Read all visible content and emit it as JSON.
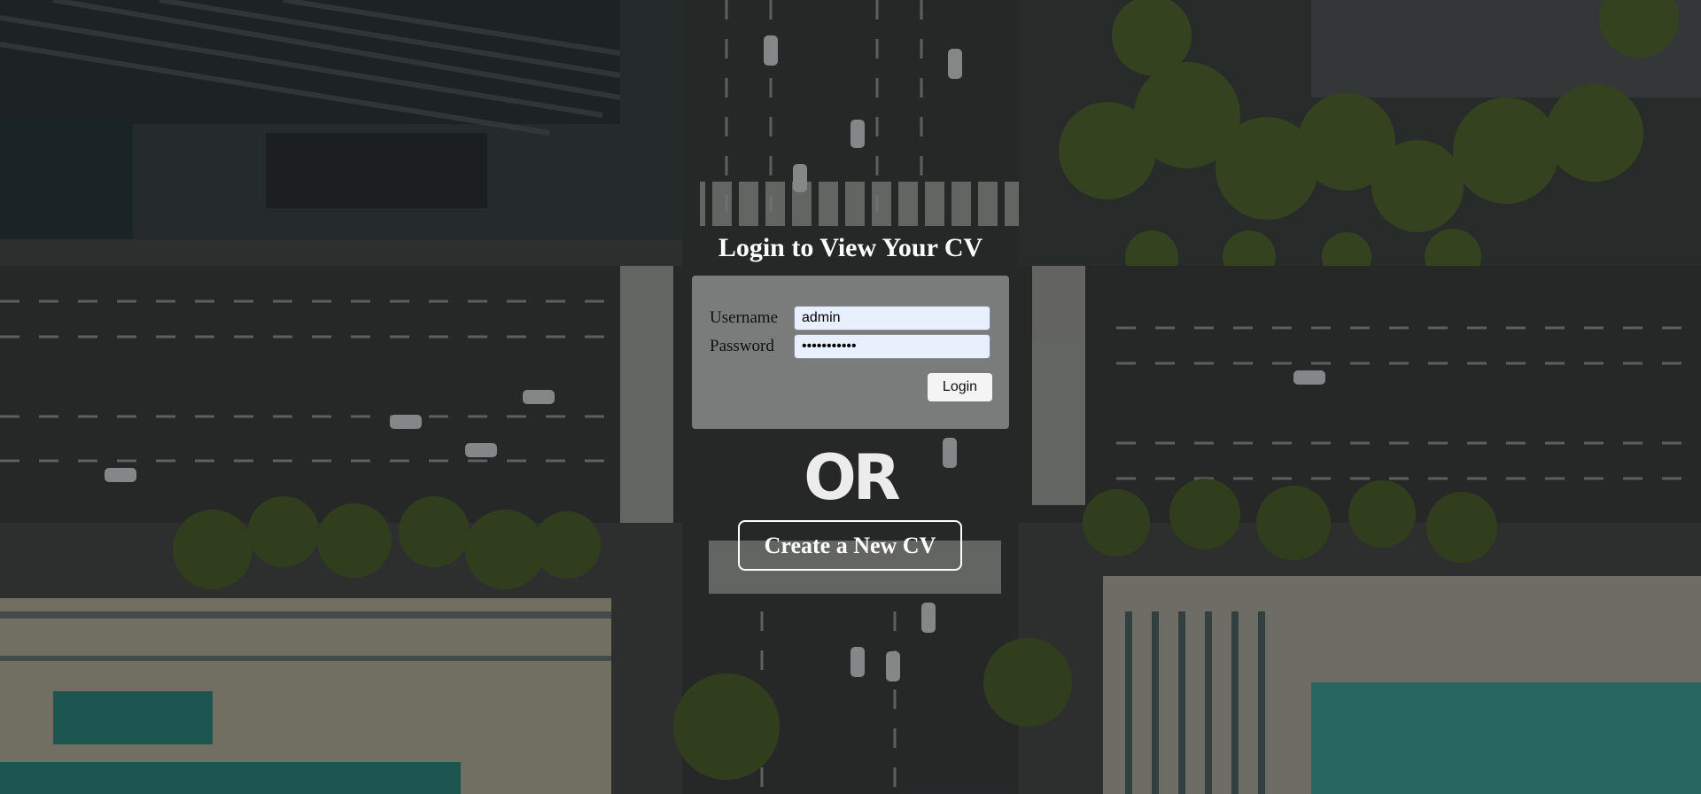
{
  "page": {
    "background": "aerial-city-intersection-photo"
  },
  "login": {
    "title": "Login to View Your CV",
    "username_label": "Username",
    "username_value": "admin",
    "password_label": "Password",
    "password_value": "•••••••••••",
    "login_button": "Login"
  },
  "divider": {
    "or_text": "OR"
  },
  "create": {
    "button_label": "Create a New CV"
  },
  "colors": {
    "title_text": "#ffffff",
    "panel_background": "rgba(200,200,200,0.52)",
    "input_background": "#e8f0fe",
    "button_background": "#f4f4f4",
    "create_border": "#ffffff"
  }
}
